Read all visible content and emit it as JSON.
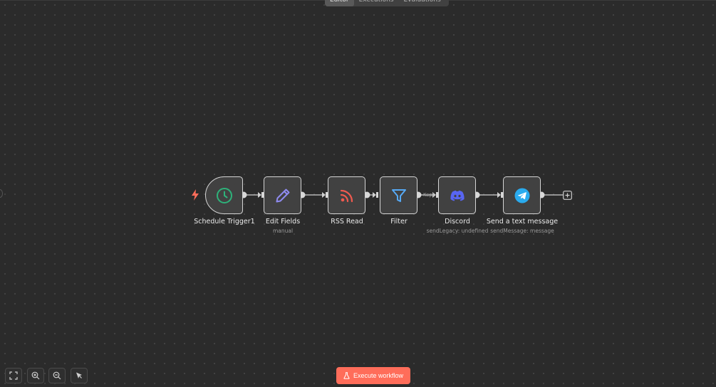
{
  "tabs": [
    {
      "label": "Editor",
      "active": true
    },
    {
      "label": "Executions",
      "active": false
    },
    {
      "label": "Evaluations",
      "active": false
    }
  ],
  "nodes": [
    {
      "id": "schedule-trigger",
      "title": "Schedule Trigger1",
      "subtitle": "",
      "icon": "clock-icon",
      "icon_color": "#2eb27a"
    },
    {
      "id": "edit-fields",
      "title": "Edit Fields",
      "subtitle": "manual",
      "icon": "pencil-icon",
      "icon_color": "#8f8bf0"
    },
    {
      "id": "rss-read",
      "title": "RSS Read",
      "subtitle": "",
      "icon": "rss-icon",
      "icon_color": "#f05a4f"
    },
    {
      "id": "filter",
      "title": "Filter",
      "subtitle": "",
      "icon": "funnel-icon",
      "icon_color": "#56a9f5"
    },
    {
      "id": "discord",
      "title": "Discord",
      "subtitle": "sendLegacy: undefined",
      "icon": "discord-icon",
      "icon_color": "#5865f2"
    },
    {
      "id": "send-text-message",
      "title": "Send a text message",
      "subtitle": "sendMessage: message",
      "icon": "telegram-icon",
      "icon_color": "#2aabee"
    }
  ],
  "edge_labels": {
    "filter_kept": "Kept"
  },
  "toolbar": {
    "execute_label": "Execute workflow"
  },
  "canvas_controls": [
    {
      "name": "fit-view",
      "icon": "fit-view-icon"
    },
    {
      "name": "zoom-in",
      "icon": "zoom-in-icon"
    },
    {
      "name": "zoom-out",
      "icon": "zoom-out-icon"
    },
    {
      "name": "select-mode",
      "icon": "cursor-icon"
    }
  ],
  "colors": {
    "accent": "#ff6d5a",
    "trigger_bolt": "#ff6d5a",
    "canvas": "#2b2b2b",
    "node_bg": "#414141"
  }
}
